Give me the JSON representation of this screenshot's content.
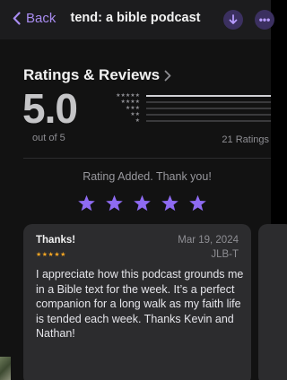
{
  "nav": {
    "back_label": "Back",
    "title": "tend: a bible podcast",
    "more_label": "•••"
  },
  "ratings": {
    "section_title": "Ratings & Reviews",
    "score": "5.0",
    "out_of": "out of 5",
    "count_text": "21 Ratings",
    "distribution": [
      {
        "stars": 5,
        "fraction": 1.0
      },
      {
        "stars": 4,
        "fraction": 0.0
      },
      {
        "stars": 3,
        "fraction": 0.0
      },
      {
        "stars": 2,
        "fraction": 0.0
      },
      {
        "stars": 1,
        "fraction": 0.0
      }
    ]
  },
  "rate": {
    "message": "Rating Added. Thank you!",
    "stars_selected": 5,
    "accent": "#8e6bf2"
  },
  "review": {
    "title": "Thanks!",
    "date": "Mar 19, 2024",
    "stars": "★★★★★",
    "author": "JLB-T",
    "body": "I appreciate how this podcast grounds me in a Bible text for the week. It’s a perfect companion for a long walk as my faith life is tended each week. Thanks Kevin and Nathan!"
  },
  "icons": {
    "back": "chevron-left-icon",
    "download": "arrow-down-icon",
    "more": "ellipsis-icon",
    "disclosure": "chevron-right-icon",
    "star": "star-icon"
  }
}
